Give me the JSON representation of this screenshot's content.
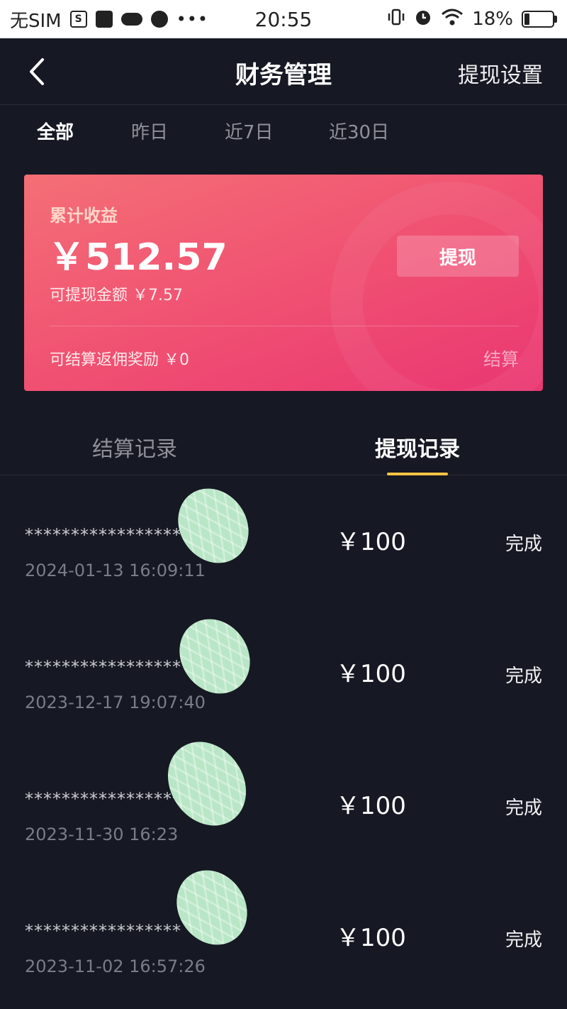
{
  "status_bar": {
    "carrier": "无SIM",
    "time": "20:55",
    "battery": "18%",
    "battery_level": 0.18,
    "icons": [
      "s-box-icon",
      "bag-icon",
      "cloud-icon",
      "planet-icon",
      "more-dots-icon",
      "vibrate-icon",
      "alarm-icon",
      "wifi-icon",
      "battery-icon"
    ]
  },
  "header": {
    "title": "财务管理",
    "right_action": "提现设置"
  },
  "filters": [
    "全部",
    "昨日",
    "近7日",
    "近30日"
  ],
  "earnings": {
    "label": "累计收益",
    "total": "￥512.57",
    "available": "可提现金额 ￥7.57",
    "withdraw_button": "提现",
    "rebate": "可结算返佣奖励 ￥0",
    "settle_link": "结算",
    "gradient_start": "#f46f76",
    "gradient_end": "#e93772"
  },
  "record_tabs": [
    "结算记录",
    "提现记录"
  ],
  "records": [
    {
      "account": "*****************",
      "date": "2024-01-13 16:09:11",
      "amount": "￥100",
      "status": "完成"
    },
    {
      "account": "*****************",
      "date": "2023-12-17 19:07:40",
      "amount": "￥100",
      "status": "完成"
    },
    {
      "account": "*****************",
      "date": "2023-11-30 16:23",
      "amount": "￥100",
      "status": "完成"
    },
    {
      "account": "*****************",
      "date": "2023-11-02 16:57:26",
      "amount": "￥100",
      "status": "完成"
    }
  ],
  "colors": {
    "background": "#161823",
    "active_tab_underline": "#f6c343",
    "redaction_mark": "#b9e6c6"
  }
}
